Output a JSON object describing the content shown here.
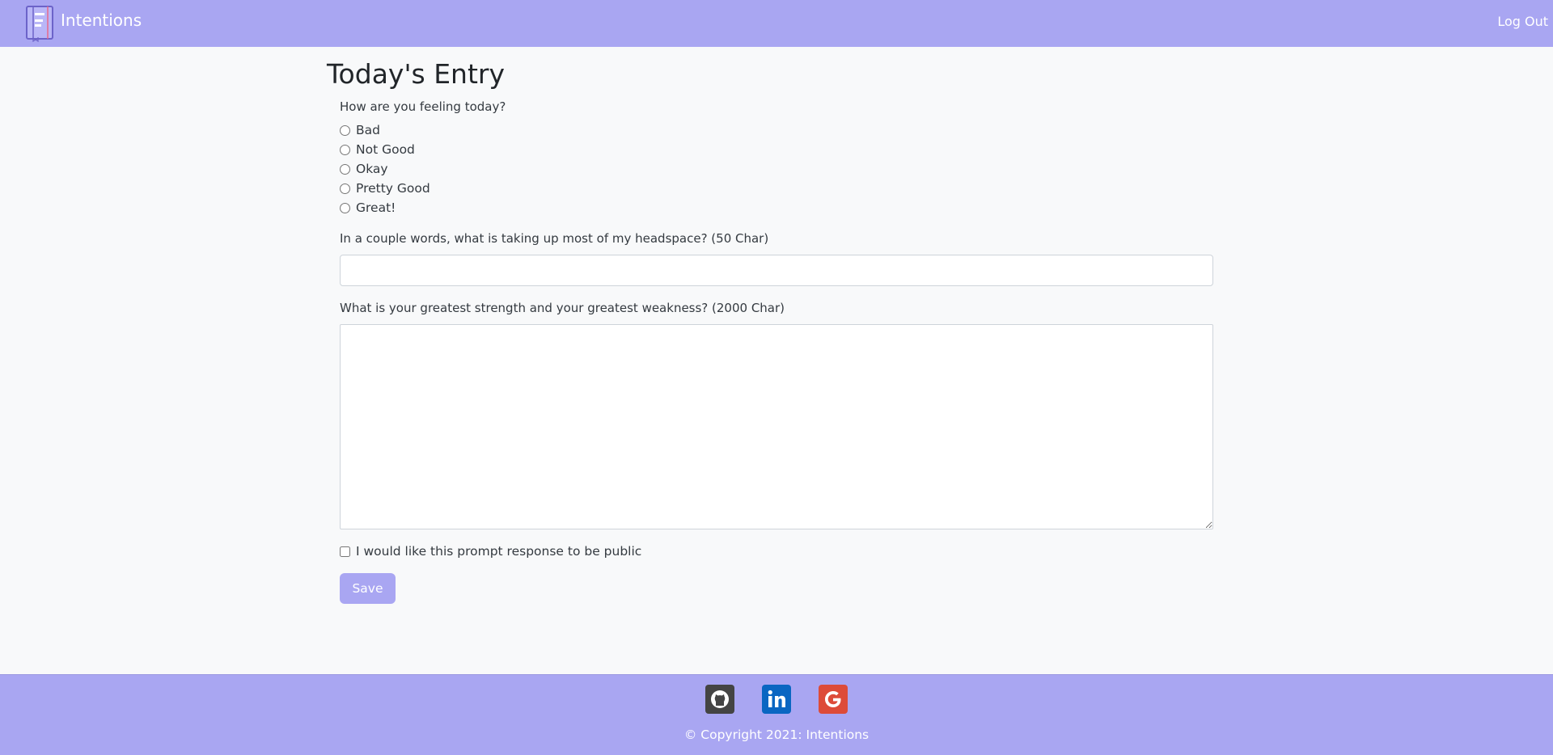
{
  "nav": {
    "brand": "Intentions",
    "logout": "Log Out",
    "brand_color": "#a9a6f2"
  },
  "page": {
    "title": "Today's Entry"
  },
  "form": {
    "feeling_question": "How are you feeling today?",
    "feeling_options": [
      "Bad",
      "Not Good",
      "Okay",
      "Pretty Good",
      "Great!"
    ],
    "headspace_question": "In a couple words, what is taking up most of my headspace? (50 Char)",
    "headspace_value": "",
    "strength_question": "What is your greatest strength and your greatest weakness? (2000 Char)",
    "strength_value": "",
    "public_label": "I would like this prompt response to be public",
    "public_checked": false,
    "save_label": "Save"
  },
  "footer": {
    "social_icons": [
      "github-icon",
      "linkedin-icon",
      "google-icon"
    ],
    "copyright": "© Copyright 2021: Intentions"
  }
}
